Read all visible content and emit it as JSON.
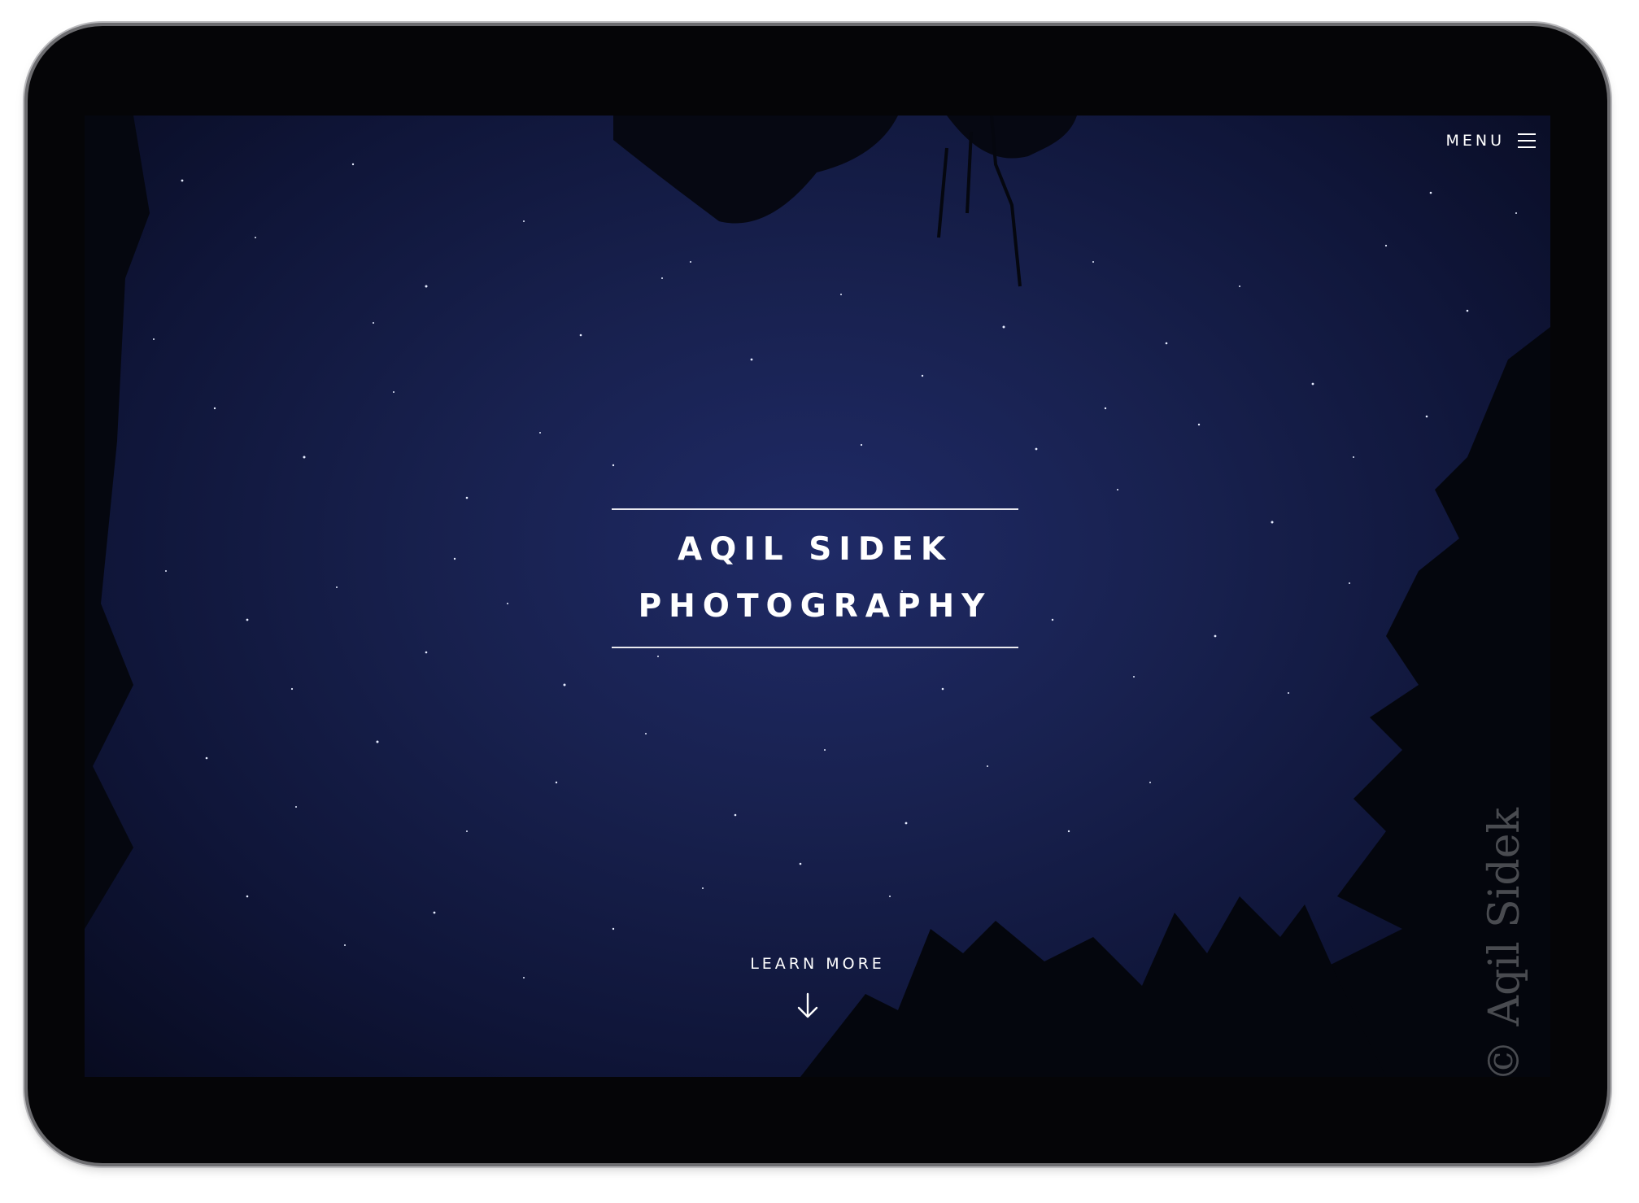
{
  "nav": {
    "menu_label": "MENU",
    "menu_icon": "hamburger-icon"
  },
  "hero": {
    "title_line1": "AQIL SIDEK",
    "title_line2": "PHOTOGRAPHY",
    "learn_more_label": "LEARN MORE",
    "scroll_icon": "arrow-down-icon"
  },
  "watermark": "© Aqil Sidek",
  "colors": {
    "sky": "#18214f",
    "text": "#ffffff",
    "device_frame": "#050507"
  }
}
